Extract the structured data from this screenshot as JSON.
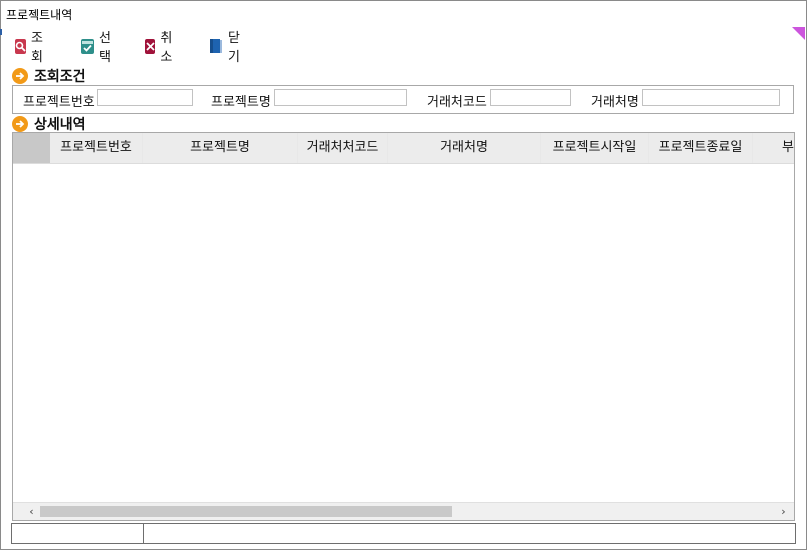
{
  "window": {
    "title": "프로젝트내역"
  },
  "toolbar": {
    "search_label": "조회",
    "select_label": "선택",
    "cancel_label": "취소",
    "close_label": "닫기",
    "colors": {
      "search": "#c8384e",
      "select": "#2e8f8a",
      "cancel": "#a0123a",
      "close": "#1e63b0"
    }
  },
  "search_section": {
    "title": "조회조건",
    "fields": [
      {
        "label": "프로젝트번호",
        "value": ""
      },
      {
        "label": "프로젝트명",
        "value": ""
      },
      {
        "label": "거래처코드",
        "value": ""
      },
      {
        "label": "거래처명",
        "value": ""
      }
    ]
  },
  "detail_section": {
    "title": "상세내역",
    "columns": [
      "프로젝트번호",
      "프로젝트명",
      "거래처처코드",
      "거래처명",
      "프로젝트시작일",
      "프로젝트종료일",
      "부"
    ],
    "rows": []
  },
  "statusbar": {
    "cell1": "",
    "cell2": ""
  },
  "colors": {
    "section_arrow": "#f29a18",
    "corner_marker": "#cc55dd"
  }
}
